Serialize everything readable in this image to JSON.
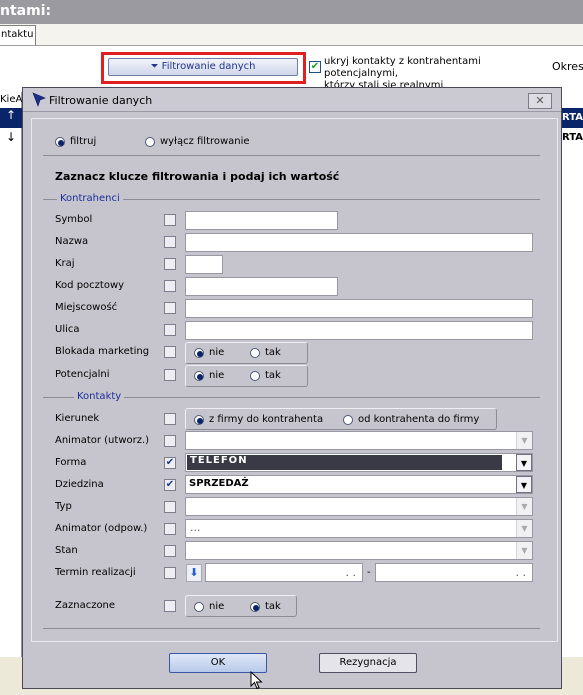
{
  "window": {
    "title_partial": "ntami:",
    "tab_label": "ntaktu"
  },
  "toolbar": {
    "filter_button_label": "Filtrowanie danych",
    "hide_checkbox_checked": true,
    "hide_checkbox_label_line1": "ukryj kontakty z kontrahentami potencjalnymi,",
    "hide_checkbox_label_line2": "którzy stali się realnymi",
    "okres_label": "Okres"
  },
  "background_grid": {
    "header_partial": "KieA",
    "row1_arrow": "↑",
    "row2_arrow": "↓",
    "right_row1": "RTA",
    "right_row2": "RTA"
  },
  "dialog": {
    "title": "Filtrowanie danych",
    "close_symbol": "✕",
    "mode": {
      "filter_label": "filtruj",
      "disable_label": "wyłącz filtrowanie",
      "selected": "filtruj"
    },
    "instruction": "Zaznacz klucze filtrowania i podaj ich wartość",
    "sections": {
      "kontrahenci": "Kontrahenci",
      "kontakty": "Kontakty"
    },
    "fields": {
      "symbol": {
        "label": "Symbol",
        "checked": false,
        "value": ""
      },
      "nazwa": {
        "label": "Nazwa",
        "checked": false,
        "value": ""
      },
      "kraj": {
        "label": "Kraj",
        "checked": false,
        "value": ""
      },
      "kod_pocztowy": {
        "label": "Kod pocztowy",
        "checked": false,
        "value": ""
      },
      "miejscowosc": {
        "label": "Miejscowość",
        "checked": false,
        "value": ""
      },
      "ulica": {
        "label": "Ulica",
        "checked": false,
        "value": ""
      },
      "blokada": {
        "label": "Blokada marketing",
        "checked": false,
        "opt_no": "nie",
        "opt_yes": "tak",
        "selected": "nie"
      },
      "potencjalni": {
        "label": "Potencjalni",
        "checked": false,
        "opt_no": "nie",
        "opt_yes": "tak",
        "selected": "nie"
      },
      "kierunek": {
        "label": "Kierunek",
        "checked": false,
        "opt_from": "z firmy do kontrahenta",
        "opt_to": "od kontrahenta do firmy",
        "selected": "z firmy do kontrahenta"
      },
      "animator_utworz": {
        "label": "Animator (utworz.)",
        "checked": false,
        "value": ""
      },
      "forma": {
        "label": "Forma",
        "checked": true,
        "value": "TELEFON"
      },
      "dziedzina": {
        "label": "Dziedzina",
        "checked": true,
        "value": "SPRZEDAŻ"
      },
      "typ": {
        "label": "Typ",
        "checked": false,
        "value": ""
      },
      "animator_odpow": {
        "label": "Animator (odpow.)",
        "checked": false,
        "value": "..."
      },
      "stan": {
        "label": "Stan",
        "checked": false,
        "value": ""
      },
      "termin": {
        "label": "Termin realizacji",
        "checked": false,
        "date_from": ". .",
        "separator": "-",
        "date_to": ". ."
      },
      "zaznaczone": {
        "label": "Zaznaczone",
        "checked": false,
        "opt_no": "nie",
        "opt_yes": "tak",
        "selected": "tak"
      }
    },
    "buttons": {
      "ok": "OK",
      "cancel": "Rezygnacja"
    }
  },
  "colors": {
    "highlight_outline": "#e02020",
    "accent_blue": "#1d2e9b",
    "selected_combo": "#3a3a46"
  }
}
